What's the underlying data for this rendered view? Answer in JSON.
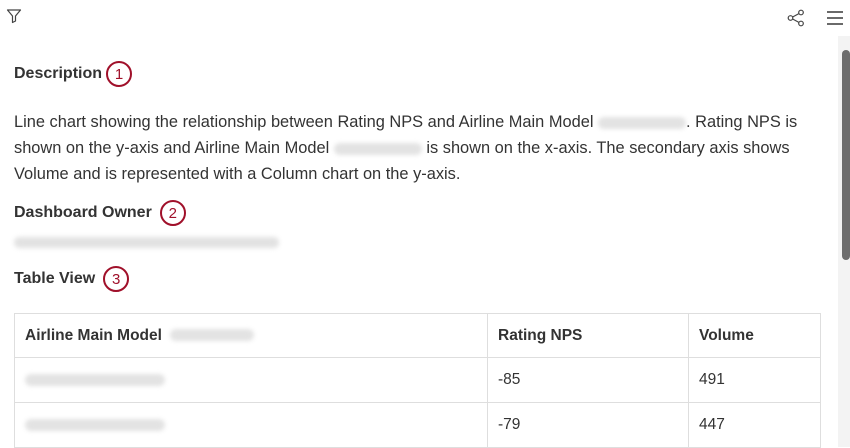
{
  "toolbar": {
    "filter_icon": "filter-icon",
    "share_icon": "share-icon",
    "menu_icon": "menu-icon"
  },
  "sections": {
    "description": {
      "title": "Description",
      "badge": "1"
    },
    "owner": {
      "title": "Dashboard Owner",
      "badge": "2"
    },
    "table_view": {
      "title": "Table View",
      "badge": "3"
    }
  },
  "description_text": {
    "part1": "Line chart showing the relationship between Rating NPS and Airline Main Model",
    "part2": ". Rating NPS is shown on the y-axis and Airline Main Model",
    "part3": "is shown on the x-axis. The secondary axis shows Volume and is represented with a Column chart on the y-axis."
  },
  "table": {
    "headers": [
      "Airline Main Model",
      "Rating NPS",
      "Volume"
    ],
    "rows": [
      {
        "rating": "-85",
        "volume": "491"
      },
      {
        "rating": "-79",
        "volume": "447"
      }
    ]
  },
  "colors": {
    "badge": "#a0102a",
    "scroll_thumb": "#6d6d6d"
  }
}
